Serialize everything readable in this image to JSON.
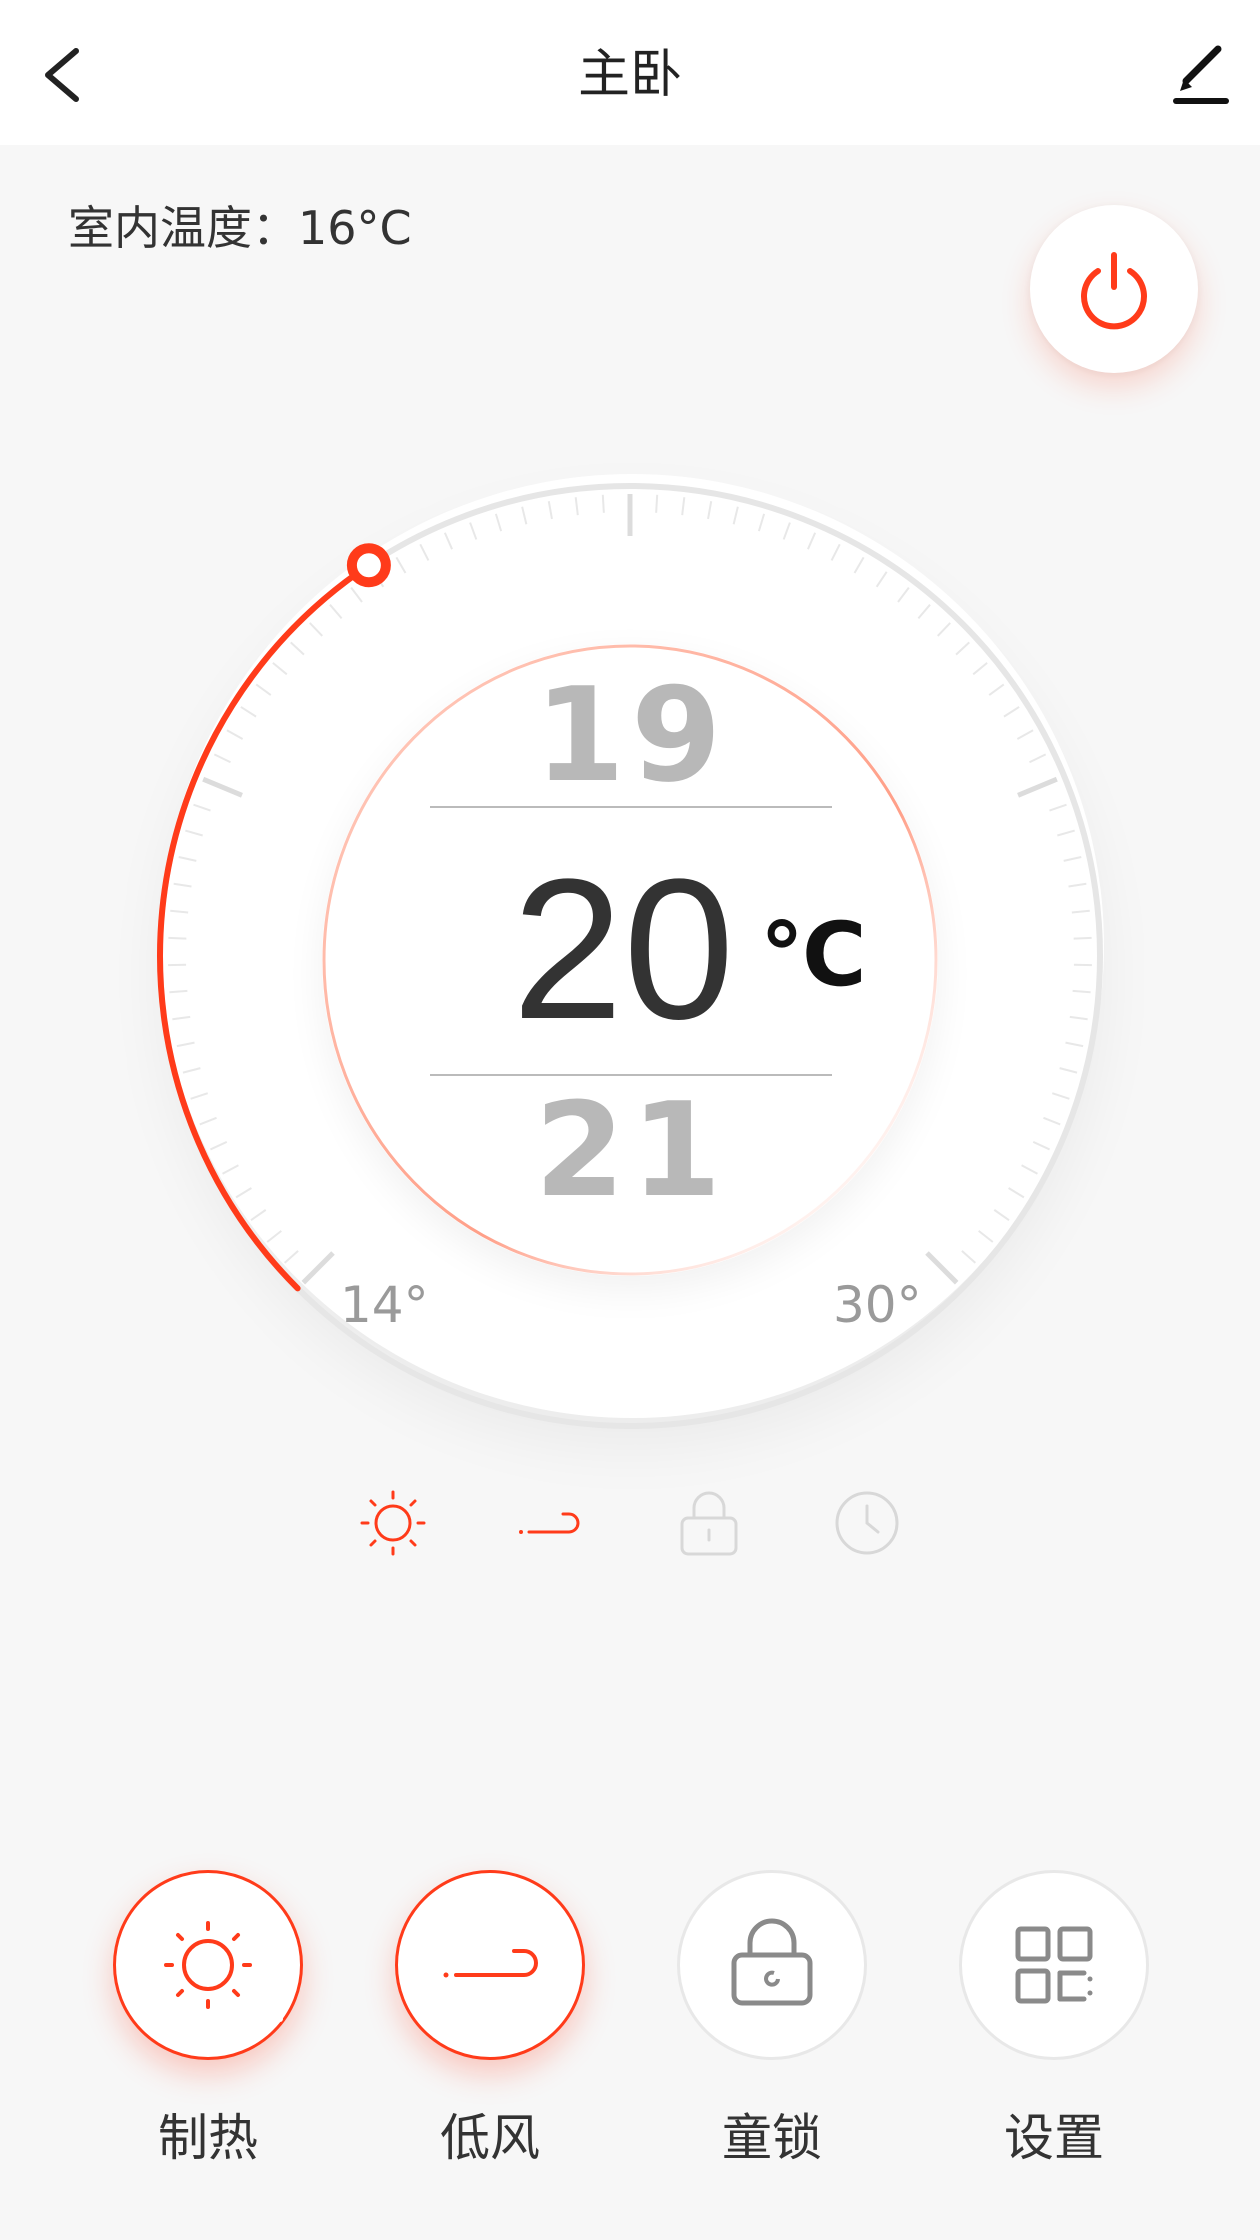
{
  "header": {
    "title": "主卧",
    "back_icon": "chevron-left-icon",
    "edit_icon": "pencil-icon"
  },
  "indoor": {
    "text": "室内温度：16°C",
    "label": "室内温度",
    "value_c": 16
  },
  "power": {
    "icon": "power-icon",
    "color": "#ff3b1a"
  },
  "dial": {
    "min_label": "14°",
    "max_label": "30°",
    "min_value": 14,
    "max_value": 30,
    "set_value": 20,
    "accent": "#ff3b1a"
  },
  "picker": {
    "prev": "19",
    "current": "20",
    "next": "21",
    "unit": "℃"
  },
  "status_icons": [
    {
      "name": "sun-icon",
      "active": true
    },
    {
      "name": "wind-icon",
      "active": true
    },
    {
      "name": "lock-icon",
      "active": false
    },
    {
      "name": "clock-icon",
      "active": false
    }
  ],
  "actions": [
    {
      "label": "制热",
      "icon": "sun-icon",
      "active": true
    },
    {
      "label": "低风",
      "icon": "wind-icon",
      "active": true
    },
    {
      "label": "童锁",
      "icon": "lock-icon",
      "active": false
    },
    {
      "label": "设置",
      "icon": "grid-icon",
      "active": false
    }
  ]
}
